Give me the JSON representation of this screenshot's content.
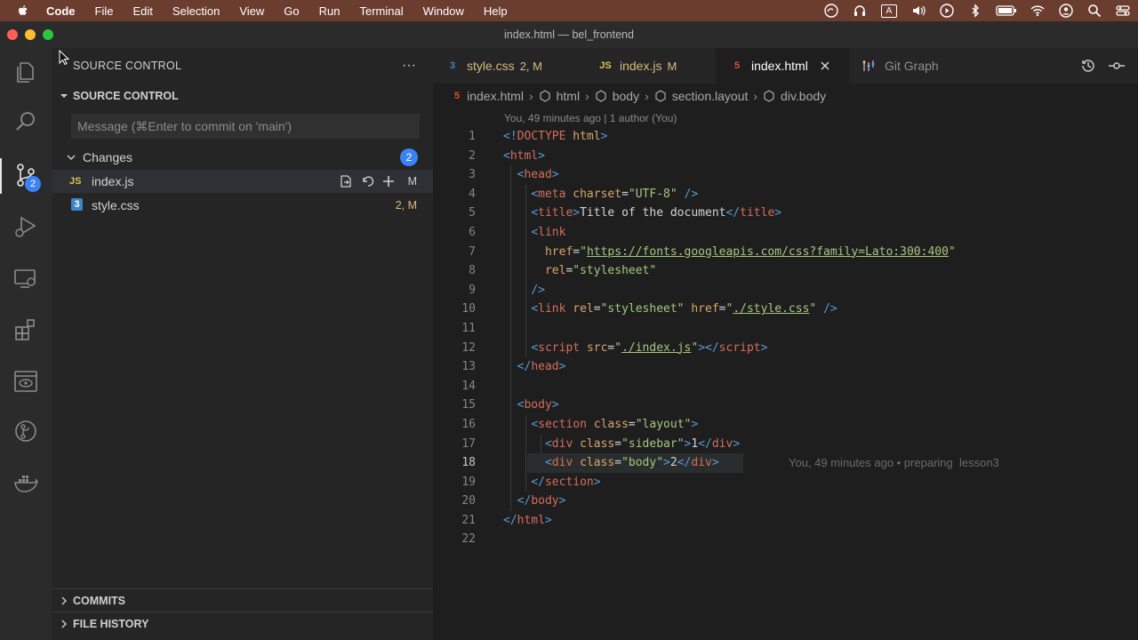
{
  "menubar": {
    "app": "Code",
    "items": [
      "File",
      "Edit",
      "Selection",
      "View",
      "Go",
      "Run",
      "Terminal",
      "Window",
      "Help"
    ],
    "input_badge": "A"
  },
  "window": {
    "title": "index.html — bel_frontend"
  },
  "activity": {
    "scm_badge": "2"
  },
  "sidebar": {
    "title": "SOURCE CONTROL",
    "section": "SOURCE CONTROL",
    "commit_placeholder": "Message (⌘Enter to commit on 'main')",
    "changes_label": "Changes",
    "changes_count": "2",
    "files": [
      {
        "icon": "JS",
        "name": "index.js",
        "status": "M"
      },
      {
        "icon": "3",
        "name": "style.css",
        "status": "2, M"
      }
    ],
    "footer": {
      "commits": "COMMITS",
      "file_history": "FILE HISTORY"
    }
  },
  "tabs": [
    {
      "icon": "3",
      "label": "style.css",
      "status": "2, M"
    },
    {
      "icon": "JS",
      "label": "index.js",
      "status": "M"
    },
    {
      "icon": "5",
      "label": "index.html",
      "status": ""
    },
    {
      "icon": "git-graph",
      "label": "Git Graph",
      "status": ""
    }
  ],
  "breadcrumb": [
    "index.html",
    "html",
    "body",
    "section.layout",
    "div.body"
  ],
  "blame_header": "You, 49 minutes ago | 1 author (You)",
  "inline_blame": "You, 49 minutes ago • preparing  lesson3",
  "code": {
    "line_numbers": [
      "1",
      "2",
      "3",
      "4",
      "5",
      "6",
      "7",
      "8",
      "9",
      "10",
      "11",
      "12",
      "13",
      "14",
      "15",
      "16",
      "17",
      "18",
      "19",
      "20",
      "21",
      "22"
    ],
    "current_line": 18,
    "l1": {
      "a": "<!",
      "b": "DOCTYPE",
      "c": " html",
      "d": ">"
    },
    "meta": {
      "attr": "charset",
      "val": "\"UTF-8\""
    },
    "title_text": "Title of the document",
    "link1": {
      "href_attr": "href",
      "href_val": "https://fonts.googleapis.com/css?family=Lato:300:400",
      "rel_attr": "rel",
      "rel_val": "\"stylesheet\""
    },
    "link2": {
      "rel_attr": "rel",
      "rel_val": "\"stylesheet\"",
      "href_attr": "href",
      "href_val": "./style.css"
    },
    "script": {
      "attr": "src",
      "val": "./index.js"
    },
    "section_class": "\"layout\"",
    "sidebar_class": "\"sidebar\"",
    "sidebar_text": "1",
    "body_class": "\"body\"",
    "body_text": "2",
    "tags": {
      "html": "html",
      "head": "head",
      "meta": "meta",
      "title": "title",
      "link": "link",
      "script": "script",
      "body": "body",
      "section": "section",
      "div": "div"
    },
    "attr_class": "class"
  }
}
